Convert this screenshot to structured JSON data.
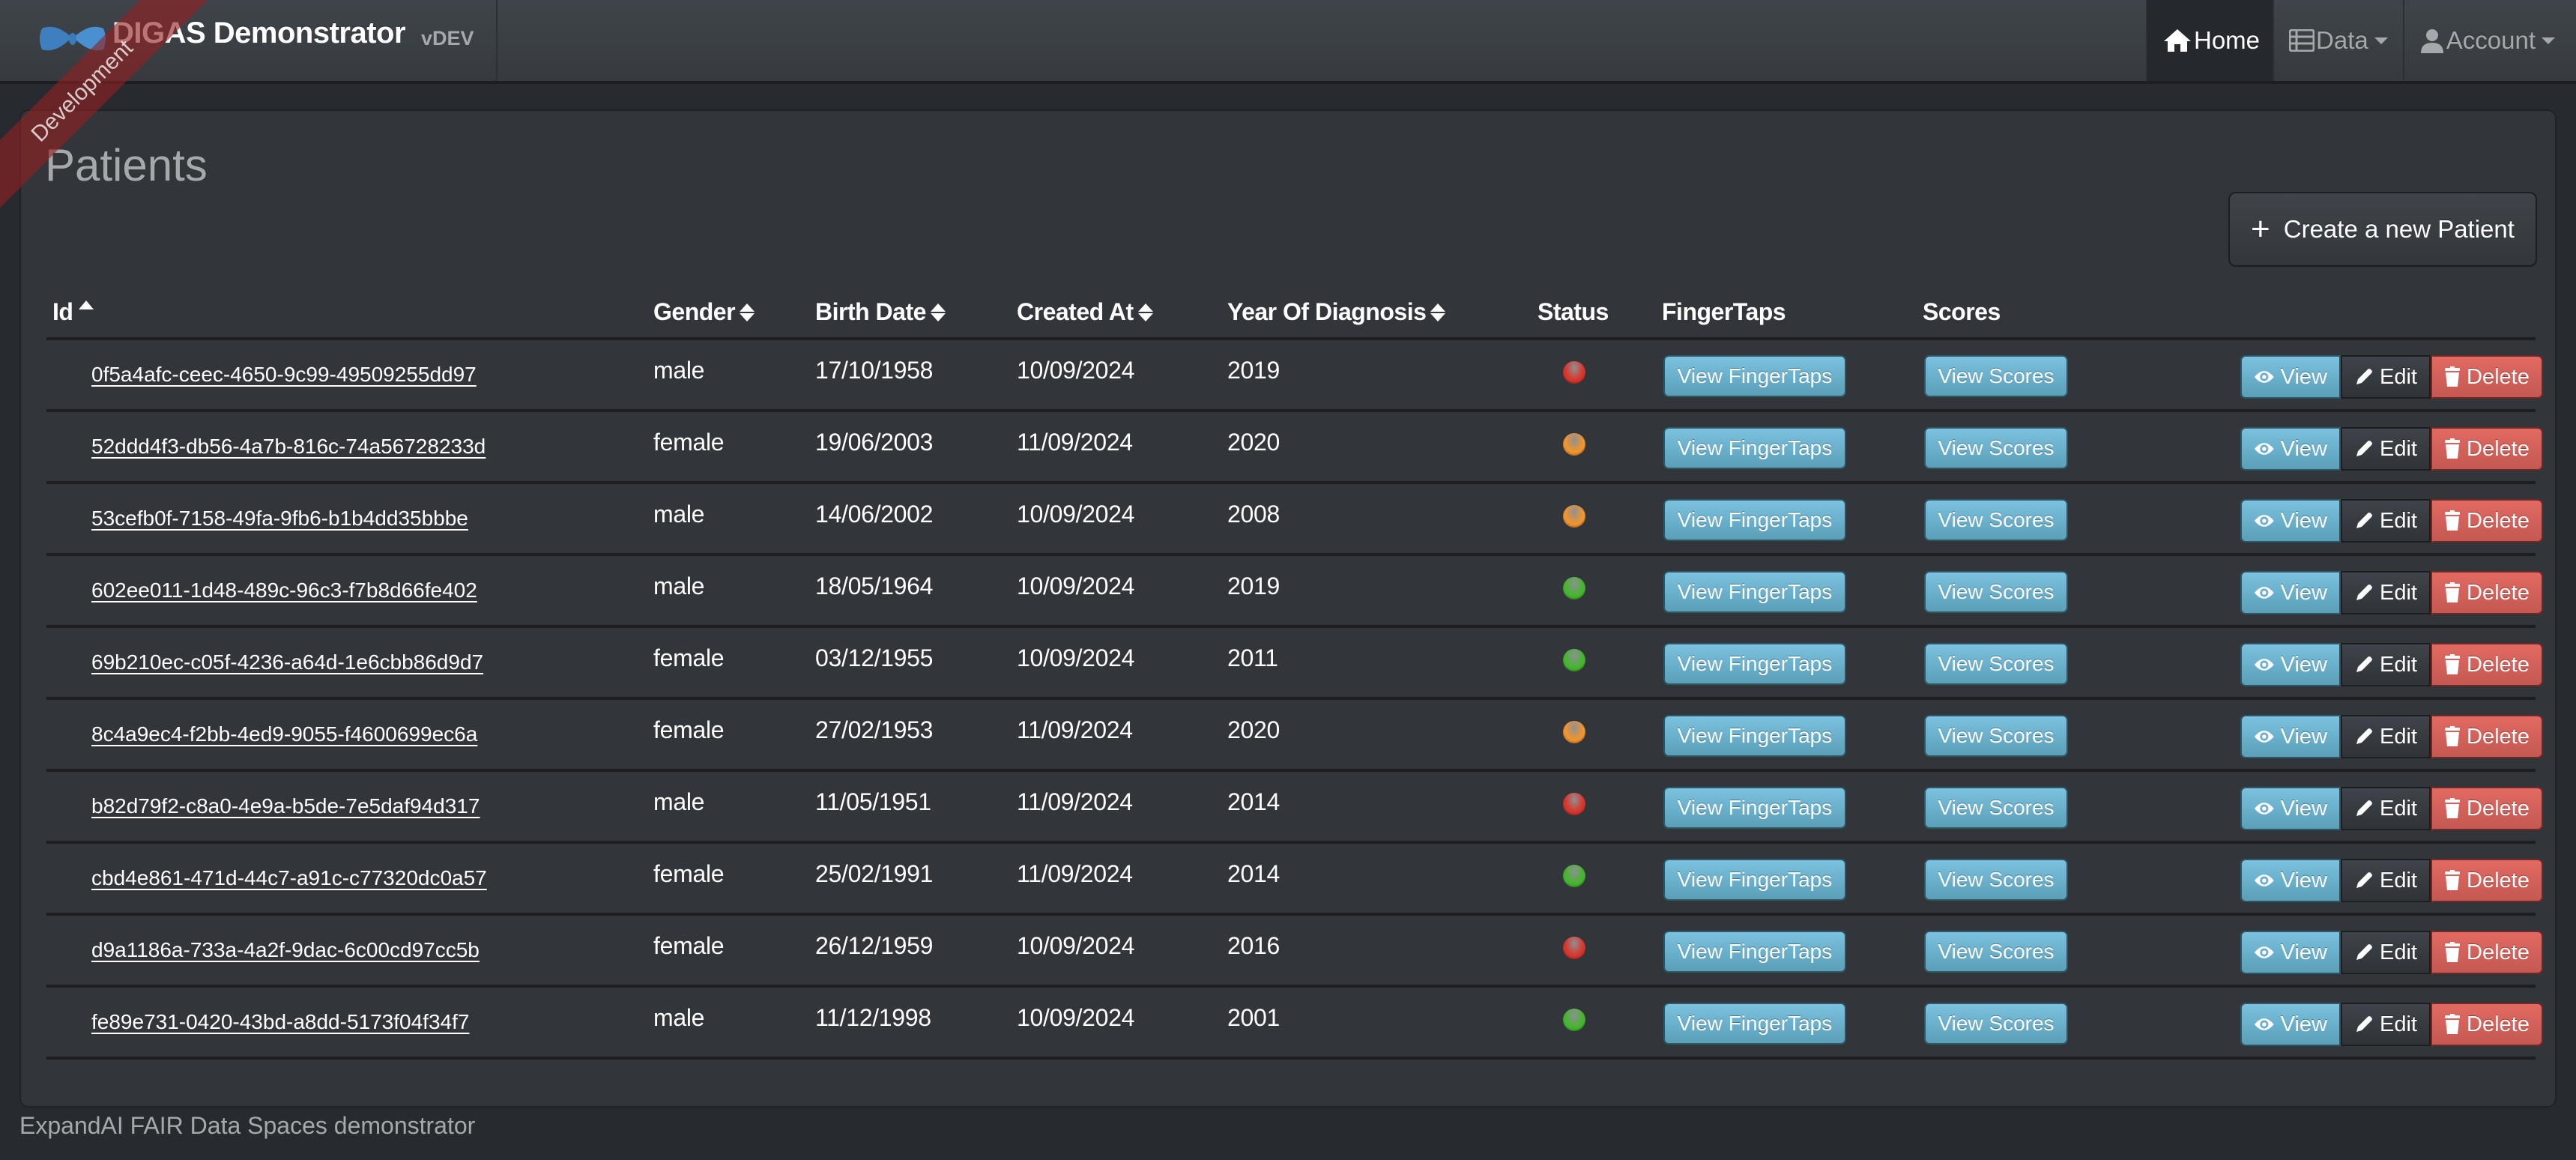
{
  "navbar": {
    "brand_title": "DIGAS Demonstrator",
    "brand_version": "vDEV",
    "logo_icon": "bowtie-logo-icon",
    "items": [
      {
        "label": "Home",
        "icon": "home-icon",
        "active": true,
        "dropdown": false
      },
      {
        "label": "Data",
        "icon": "table-icon",
        "active": false,
        "dropdown": true
      },
      {
        "label": "Account",
        "icon": "user-icon",
        "active": false,
        "dropdown": true
      }
    ]
  },
  "ribbon": {
    "label": "Development"
  },
  "page": {
    "title": "Patients",
    "create_button": {
      "label": "Create a new Patient",
      "icon": "plus-icon"
    }
  },
  "table": {
    "columns": [
      {
        "label": "Id",
        "sort": "asc"
      },
      {
        "label": "Gender",
        "sort": "both"
      },
      {
        "label": "Birth Date",
        "sort": "both"
      },
      {
        "label": "Created At",
        "sort": "both"
      },
      {
        "label": "Year Of Diagnosis",
        "sort": "both"
      },
      {
        "label": "Status",
        "sort": null
      },
      {
        "label": "FingerTaps",
        "sort": null
      },
      {
        "label": "Scores",
        "sort": null
      }
    ],
    "button_labels": {
      "fingertaps": "View FingerTaps",
      "scores": "View Scores",
      "view": "View",
      "edit": "Edit",
      "delete": "Delete"
    },
    "status_colors": {
      "red": "#d9362c",
      "orange": "#f0942e",
      "green": "#46b52f"
    },
    "rows": [
      {
        "id": "0f5a4afc-ceec-4650-9c99-49509255dd97",
        "gender": "male",
        "birth_date": "17/10/1958",
        "created_at": "10/09/2024",
        "year_of_diagnosis": "2019",
        "status": "red"
      },
      {
        "id": "52ddd4f3-db56-4a7b-816c-74a56728233d",
        "gender": "female",
        "birth_date": "19/06/2003",
        "created_at": "11/09/2024",
        "year_of_diagnosis": "2020",
        "status": "orange"
      },
      {
        "id": "53cefb0f-7158-49fa-9fb6-b1b4dd35bbbe",
        "gender": "male",
        "birth_date": "14/06/2002",
        "created_at": "10/09/2024",
        "year_of_diagnosis": "2008",
        "status": "orange"
      },
      {
        "id": "602ee011-1d48-489c-96c3-f7b8d66fe402",
        "gender": "male",
        "birth_date": "18/05/1964",
        "created_at": "10/09/2024",
        "year_of_diagnosis": "2019",
        "status": "green"
      },
      {
        "id": "69b210ec-c05f-4236-a64d-1e6cbb86d9d7",
        "gender": "female",
        "birth_date": "03/12/1955",
        "created_at": "10/09/2024",
        "year_of_diagnosis": "2011",
        "status": "green"
      },
      {
        "id": "8c4a9ec4-f2bb-4ed9-9055-f4600699ec6a",
        "gender": "female",
        "birth_date": "27/02/1953",
        "created_at": "11/09/2024",
        "year_of_diagnosis": "2020",
        "status": "orange"
      },
      {
        "id": "b82d79f2-c8a0-4e9a-b5de-7e5daf94d317",
        "gender": "male",
        "birth_date": "11/05/1951",
        "created_at": "11/09/2024",
        "year_of_diagnosis": "2014",
        "status": "red"
      },
      {
        "id": "cbd4e861-471d-44c7-a91c-c77320dc0a57",
        "gender": "female",
        "birth_date": "25/02/1991",
        "created_at": "11/09/2024",
        "year_of_diagnosis": "2014",
        "status": "green"
      },
      {
        "id": "d9a1186a-733a-4a2f-9dac-6c00cd97cc5b",
        "gender": "female",
        "birth_date": "26/12/1959",
        "created_at": "10/09/2024",
        "year_of_diagnosis": "2016",
        "status": "red"
      },
      {
        "id": "fe89e731-0420-43bd-a8dd-5173f04f34f7",
        "gender": "male",
        "birth_date": "11/12/1998",
        "created_at": "10/09/2024",
        "year_of_diagnosis": "2001",
        "status": "green"
      }
    ]
  },
  "footer": {
    "text": "ExpandAI FAIR Data Spaces demonstrator"
  }
}
